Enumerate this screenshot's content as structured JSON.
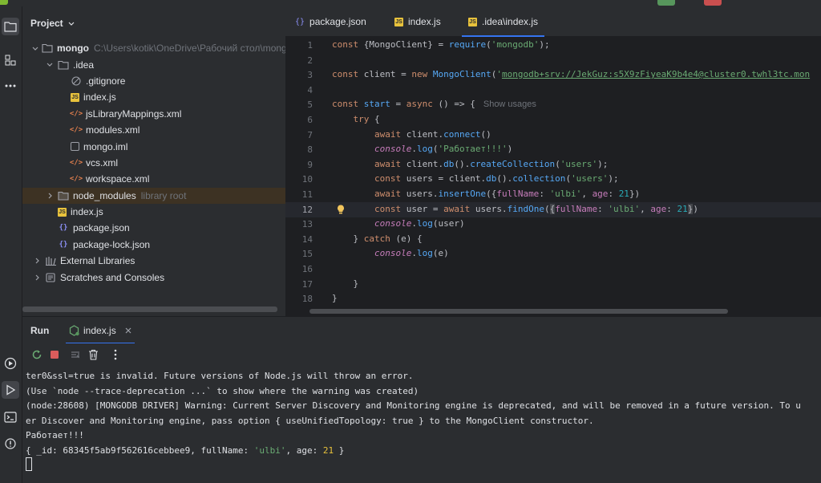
{
  "colors": {
    "accent": "#3574f0",
    "keyword": "#cf8e6d",
    "string": "#6aab73",
    "number": "#2aacb8",
    "function": "#56a8f5",
    "console_obj": "#c77dbb"
  },
  "project": {
    "title": "Project",
    "root": {
      "name": "mongo",
      "path": "C:\\Users\\kotik\\OneDrive\\Рабочий стол\\mong"
    },
    "idea_folder": ".idea",
    "idea_files": [
      ".gitignore",
      "index.js",
      "jsLibraryMappings.xml",
      "modules.xml",
      "mongo.iml",
      "vcs.xml",
      "workspace.xml"
    ],
    "node_modules": {
      "name": "node_modules",
      "hint": "library root"
    },
    "root_files": [
      "index.js",
      "package.json",
      "package-lock.json"
    ],
    "external_libraries": "External Libraries",
    "scratches": "Scratches and Consoles"
  },
  "editor": {
    "tabs": [
      "package.json",
      "index.js",
      ".idea\\index.js"
    ],
    "active_tab": ".idea\\index.js",
    "show_usages": "Show usages",
    "current_line": 12,
    "line_numbers": [
      "1",
      "2",
      "3",
      "4",
      "5",
      "6",
      "7",
      "8",
      "9",
      "10",
      "11",
      "12",
      "13",
      "14",
      "15",
      "16",
      "17",
      "18"
    ]
  },
  "run": {
    "title": "Run",
    "tab": "index.js",
    "console_lines": [
      "ter0&ssl=true is invalid. Future versions of Node.js will throw an error.",
      "(Use `node --trace-deprecation ...` to show where the warning was created)",
      "(node:28608) [MONGODB DRIVER] Warning: Current Server Discovery and Monitoring engine is deprecated, and will be removed in a future version. To u",
      "er Discover and Monitoring engine, pass option { useUnifiedTopology: true } to the MongoClient constructor.",
      "Работает!!!"
    ],
    "result": {
      "prefix": "{ _id: 68345f5ab9f562616cebbee9, fullName: ",
      "name": "'ulbi'",
      "mid": ", age: ",
      "age": "21",
      "suffix": " }"
    }
  }
}
